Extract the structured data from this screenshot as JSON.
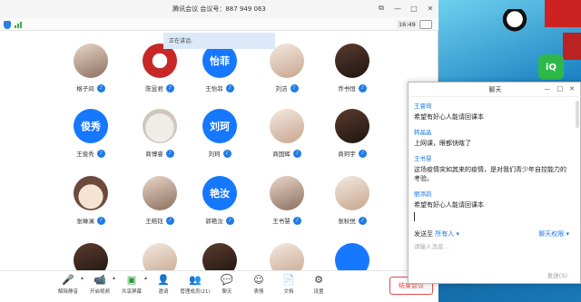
{
  "window": {
    "title": "腾讯会议 会议号：887 949 063",
    "clock": "16:49"
  },
  "speaking": "正在讲话:",
  "participants": [
    {
      "name": "格子间",
      "avatar_text": "",
      "style": "av-photo"
    },
    {
      "name": "陈昱君",
      "avatar_text": "",
      "style": "av-red"
    },
    {
      "name": "王怡菲",
      "avatar_text": "怡菲",
      "style": "av-text"
    },
    {
      "name": "刘洁",
      "avatar_text": "",
      "style": "av-photo2"
    },
    {
      "name": "乔书恒",
      "avatar_text": "",
      "style": "av-dark"
    },
    {
      "name": "王俊秀",
      "avatar_text": "俊秀",
      "style": "av-text"
    },
    {
      "name": "商博睿",
      "avatar_text": "",
      "style": "av-cat"
    },
    {
      "name": "刘珂",
      "avatar_text": "刘珂",
      "style": "av-text"
    },
    {
      "name": "商国辉",
      "avatar_text": "",
      "style": "av-photo2"
    },
    {
      "name": "商珂宇",
      "avatar_text": "",
      "style": "av-dark"
    },
    {
      "name": "张琳澜",
      "avatar_text": "",
      "style": "av-cartoon"
    },
    {
      "name": "王皓钰",
      "avatar_text": "",
      "style": "av-photo"
    },
    {
      "name": "郭艳汝",
      "avatar_text": "艳汝",
      "style": "av-text"
    },
    {
      "name": "王书慧",
      "avatar_text": "",
      "style": "av-photo"
    },
    {
      "name": "张秋悦",
      "avatar_text": "",
      "style": "av-photo2"
    }
  ],
  "toolbar": {
    "mute": "解除静音",
    "video": "开启视频",
    "share": "共享屏幕",
    "invite": "邀请",
    "members": "管理成员(21)",
    "chat": "聊天",
    "emoji": "表情",
    "docs": "文档",
    "settings": "设置",
    "end": "结束会议"
  },
  "chat": {
    "title": "聊天",
    "messages": [
      {
        "sender": "王睿琦",
        "text": "希望有好心人能请回课本"
      },
      {
        "sender": "韩晶晶",
        "text": "上网课，眼都快瞎了"
      },
      {
        "sender": "王书慧",
        "text": "这场疫情突如其来的疫情，是对我们青少年自控能力的"
      },
      {
        "sender": "",
        "text": "考验。"
      },
      {
        "sender": "丽添韵",
        "text": "希望有好心人能请回课本"
      }
    ],
    "send_to_label": "发送至",
    "send_to_target": "所有人",
    "permission": "聊天权限",
    "placeholder": "请输入消息...",
    "send_button": "发送(S)"
  },
  "icons": {
    "mic": "mic-off-icon",
    "video": "video-off-icon",
    "share": "share-screen-icon",
    "invite": "invite-icon",
    "members": "members-icon",
    "chat": "chat-icon",
    "emoji": "emoji-icon",
    "docs": "document-icon",
    "settings": "settings-icon"
  }
}
